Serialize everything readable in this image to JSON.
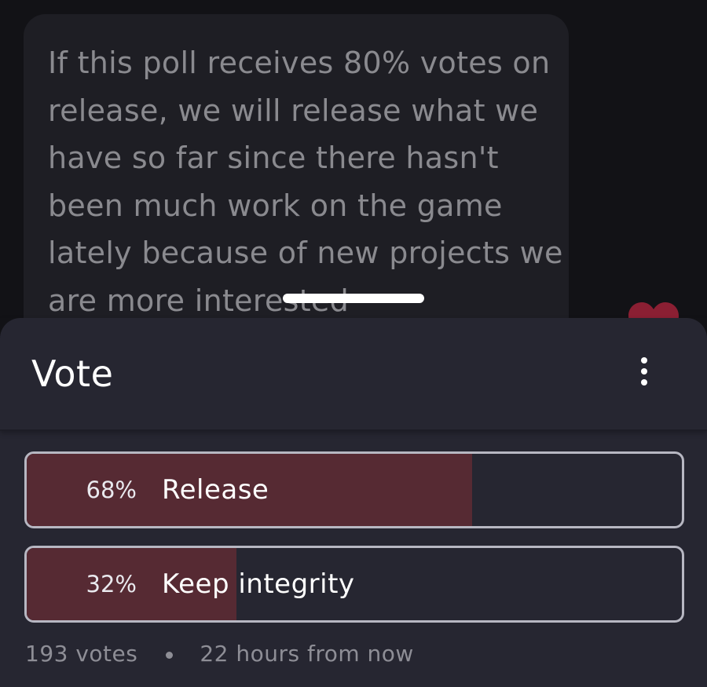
{
  "message": {
    "text": "If this poll receives 80% votes on release, we will release what we have so far since there hasn't been much work on the game lately because of new projects we are more interested"
  },
  "poll": {
    "title": "Vote",
    "menu_icon": "more-vertical-icon",
    "options": [
      {
        "percent": "68%",
        "label": "Release",
        "share": 0.68
      },
      {
        "percent": "32%",
        "label": "Keep integrity",
        "share": 0.32
      }
    ],
    "votes": "193 votes",
    "closes": "22 hours from now"
  },
  "colors": {
    "fill": "#562a33",
    "heart": "#8b1f33",
    "sheet": "#262631"
  }
}
